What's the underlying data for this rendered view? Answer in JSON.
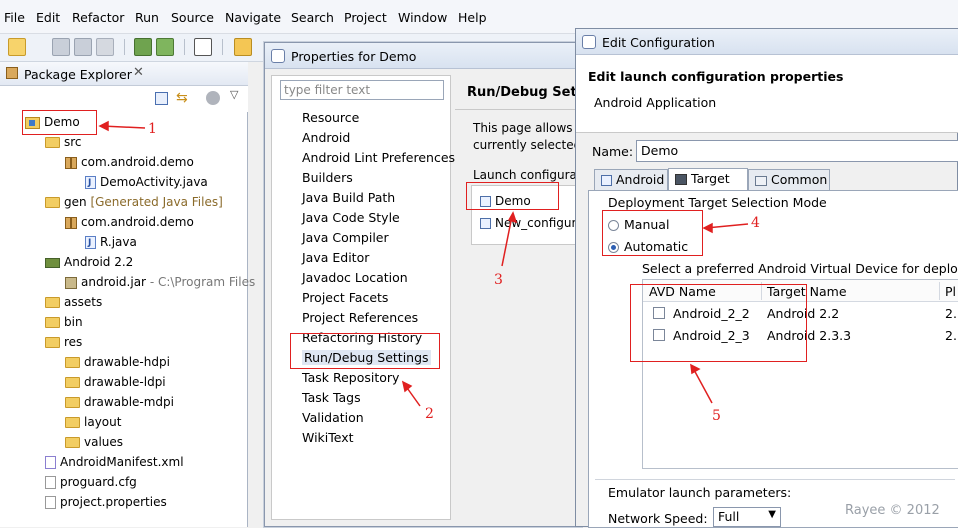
{
  "menubar": {
    "items": [
      "File",
      "Edit",
      "Refactor",
      "Run",
      "Source",
      "Navigate",
      "Search",
      "Project",
      "Window",
      "Help"
    ]
  },
  "package_explorer": {
    "title": "Package Explorer",
    "tree": [
      {
        "label": "Demo",
        "icon": "project-icon"
      },
      {
        "label": "src",
        "icon": "folder-icon"
      },
      {
        "label": "com.android.demo",
        "icon": "package-icon"
      },
      {
        "label": "DemoActivity.java",
        "icon": "java-file-icon"
      },
      {
        "label": "gen",
        "suffix": "[Generated Java Files]",
        "icon": "folder-icon"
      },
      {
        "label": "com.android.demo",
        "icon": "package-icon"
      },
      {
        "label": "R.java",
        "icon": "java-file-icon"
      },
      {
        "label": "Android 2.2",
        "icon": "library-icon"
      },
      {
        "label": "android.jar",
        "suffix": "- C:\\Program Files",
        "icon": "jar-icon"
      },
      {
        "label": "assets",
        "icon": "folder-icon"
      },
      {
        "label": "bin",
        "icon": "folder-icon"
      },
      {
        "label": "res",
        "icon": "folder-icon"
      },
      {
        "label": "drawable-hdpi",
        "icon": "folder-icon"
      },
      {
        "label": "drawable-ldpi",
        "icon": "folder-icon"
      },
      {
        "label": "drawable-mdpi",
        "icon": "folder-icon"
      },
      {
        "label": "layout",
        "icon": "folder-icon"
      },
      {
        "label": "values",
        "icon": "folder-icon"
      },
      {
        "label": "AndroidManifest.xml",
        "icon": "xml-file-icon"
      },
      {
        "label": "proguard.cfg",
        "icon": "file-icon"
      },
      {
        "label": "project.properties",
        "icon": "file-icon"
      }
    ]
  },
  "properties_dialog": {
    "title": "Properties for Demo",
    "filter_placeholder": "type filter text",
    "items": [
      "Resource",
      "Android",
      "Android Lint Preferences",
      "Builders",
      "Java Build Path",
      "Java Code Style",
      "Java Compiler",
      "Java Editor",
      "Javadoc Location",
      "Project Facets",
      "Project References",
      "Refactoring History",
      "Run/Debug Settings",
      "Task Repository",
      "Task Tags",
      "Validation",
      "WikiText"
    ],
    "page_title": "Run/Debug Settings",
    "desc_line1": "This page allows",
    "desc_line2": "currently selected",
    "launch_label": "Launch configurat",
    "configs": [
      "Demo",
      "New_configur"
    ]
  },
  "edit_config": {
    "title": "Edit Configuration",
    "heading": "Edit launch configuration properties",
    "subheading": "Android Application",
    "name_label": "Name:",
    "name_value": "Demo",
    "tabs": [
      "Android",
      "Target",
      "Common"
    ],
    "deploy_label": "Deployment Target Selection Mode",
    "manual": "Manual",
    "automatic": "Automatic",
    "select_avd": "Select a preferred Android Virtual Device for deploym",
    "avd_headers": [
      "AVD Name",
      "Target Name",
      "Pl"
    ],
    "avds": [
      {
        "name": "Android_2_2",
        "target": "Android 2.2",
        "platform": "2."
      },
      {
        "name": "Android_2_3",
        "target": "Android 2.3.3",
        "platform": "2."
      }
    ],
    "emulator_label": "Emulator launch parameters:",
    "network_speed_label": "Network Speed:",
    "network_speed_value": "Full"
  },
  "annotations": [
    "1",
    "2",
    "3",
    "4",
    "5"
  ],
  "watermark": "Rayee © 2012"
}
